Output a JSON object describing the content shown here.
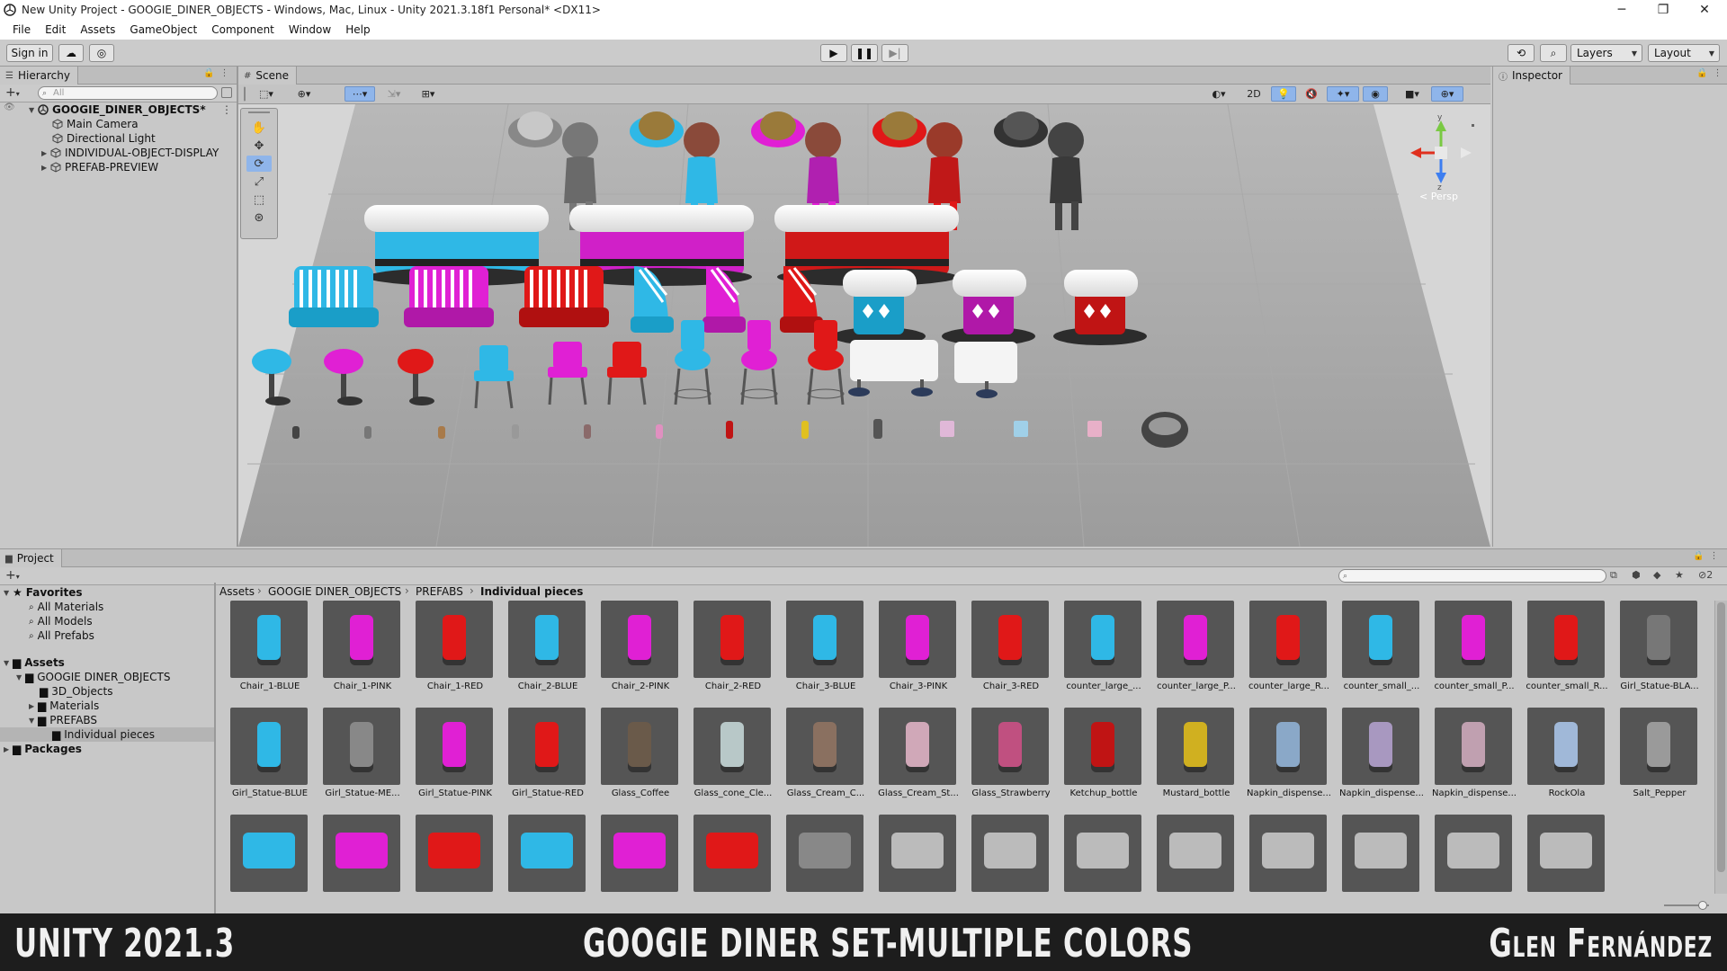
{
  "titlebar": {
    "title": "New Unity Project - GOOGIE_DINER_OBJECTS - Windows, Mac, Linux - Unity 2021.3.18f1 Personal* <DX11>",
    "minimize": "─",
    "maximize": "❐",
    "close": "✕"
  },
  "menu": [
    "File",
    "Edit",
    "Assets",
    "GameObject",
    "Component",
    "Window",
    "Help"
  ],
  "toolbar": {
    "sign_in": "Sign in",
    "layers": "Layers",
    "layout": "Layout"
  },
  "hierarchy": {
    "tab": "Hierarchy",
    "search_placeholder": "All",
    "scene": "GOOGIE_DINER_OBJECTS*",
    "items": [
      "Main Camera",
      "Directional Light",
      "INDIVIDUAL-OBJECT-DISPLAY",
      "PREFAB-PREVIEW"
    ]
  },
  "scene": {
    "tab": "Scene",
    "mode_2d": "2D",
    "persp": "< Persp",
    "gizmo_y": "y",
    "gizmo_z": "z"
  },
  "inspector": {
    "tab": "Inspector"
  },
  "project": {
    "tab": "Project",
    "visibility_count": "2",
    "favorites": {
      "label": "Favorites",
      "items": [
        "All Materials",
        "All Models",
        "All Prefabs"
      ]
    },
    "assets": {
      "label": "Assets",
      "root": "GOOGIE DINER_OBJECTS",
      "children": [
        "3D_Objects",
        "Materials",
        "PREFABS"
      ],
      "selected": "Individual pieces"
    },
    "packages": "Packages",
    "breadcrumb": [
      "Assets",
      "GOOGIE DINER_OBJECTS",
      "PREFABS",
      "Individual pieces"
    ],
    "items_row1": [
      "Chair_1-BLUE",
      "Chair_1-PINK",
      "Chair_1-RED",
      "Chair_2-BLUE",
      "Chair_2-PINK",
      "Chair_2-RED",
      "Chair_3-BLUE",
      "Chair_3-PINK",
      "Chair_3-RED",
      "counter_large_...",
      "counter_large_P...",
      "counter_large_R...",
      "counter_small_...",
      "counter_small_P...",
      "counter_small_R...",
      "Girl_Statue-BLA..."
    ],
    "items_row2": [
      "Girl_Statue-BLUE",
      "Girl_Statue-ME...",
      "Girl_Statue-PINK",
      "Girl_Statue-RED",
      "Glass_Coffee",
      "Glass_cone_Cle...",
      "Glass_Cream_C...",
      "Glass_Cream_St...",
      "Glass_Strawberry",
      "Ketchup_bottle",
      "Mustard_bottle",
      "Napkin_dispense...",
      "Napkin_dispense...",
      "Napkin_dispense...",
      "RockOla",
      "Salt_Pepper"
    ]
  },
  "banner": {
    "left": "UNITY 2021.3",
    "center": "GOOGIE DINER SET-MULTIPLE COLORS",
    "right": "Glen Fernández"
  },
  "colors": {
    "blue": "#2fb8e6",
    "pink": "#e020d4",
    "red": "#e01818",
    "accent": "#8fb5ea"
  }
}
